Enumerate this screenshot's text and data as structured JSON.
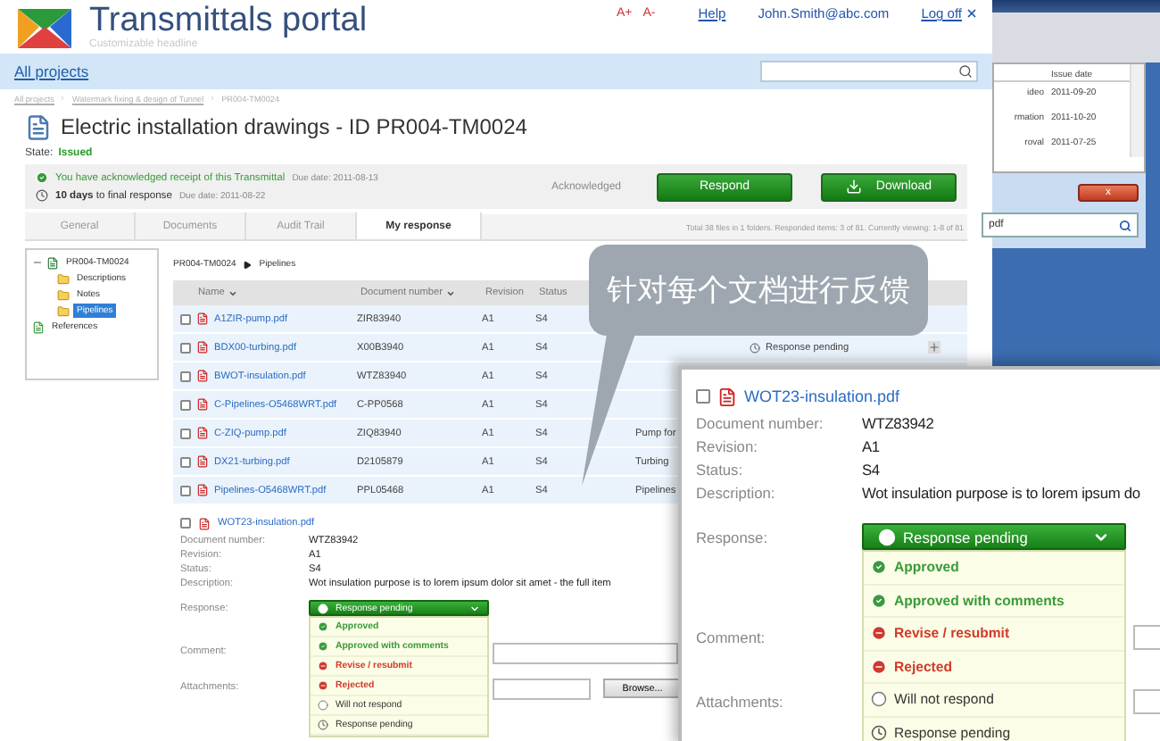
{
  "header": {
    "title": "Transmittals portal",
    "subtitle": "Customizable headline",
    "font_buttons": [
      "A+",
      "A-"
    ],
    "links": [
      "Help",
      "John.Smith@abc.com",
      "Log off"
    ]
  },
  "nav": {
    "link": "All projects"
  },
  "breadcrumb": [
    "All projects",
    "Watermark fixing & design of Tunnel",
    "PR004-TM0024"
  ],
  "page": {
    "title": "Electric installation drawings - ID PR004-TM0024",
    "state_label": "State:",
    "state": "Issued"
  },
  "notice": {
    "lines": [
      {
        "kind": "ack",
        "text": "You have acknowledged receipt of this Transmittal",
        "due": "Due date: 2011-08-13"
      },
      {
        "kind": "deadline",
        "text": "**10 days** to final response",
        "due": "Due date: 2011-08-22"
      }
    ],
    "status": "Acknowledged",
    "buttons": [
      {
        "kind": "respond",
        "label": "Respond"
      },
      {
        "kind": "download",
        "label": "Download"
      }
    ]
  },
  "tabs": [
    {
      "label": "General",
      "selected": false
    },
    {
      "label": "Documents",
      "selected": false
    },
    {
      "label": "Audit Trail",
      "selected": false
    },
    {
      "label": "My response",
      "selected": true
    }
  ],
  "summary": "Total 38 files in 1 folders. Responded items: 3 of 81. Currently viewing: 1-8 of 81",
  "tree": [
    {
      "label": "PR004-TM0024",
      "kind": "project",
      "expanded": true,
      "selected": false,
      "children": [
        {
          "label": "Descriptions",
          "kind": "folder",
          "selected": false
        },
        {
          "label": "Notes",
          "kind": "folder",
          "selected": false
        },
        {
          "label": "Pipelines",
          "kind": "folder",
          "selected": true
        }
      ]
    },
    {
      "label": "References",
      "kind": "references",
      "selected": false
    }
  ],
  "path": [
    "PR004-TM0024",
    "Pipelines"
  ],
  "table": {
    "columns": [
      {
        "label": "Name",
        "sortable": true
      },
      {
        "label": "Document number",
        "sortable": true
      },
      {
        "label": "Revision",
        "sortable": false
      },
      {
        "label": "Status",
        "sortable": false
      }
    ],
    "rows": [
      {
        "name": "A1ZIR-pump.pdf",
        "number": "ZIR83940",
        "revision": "A1",
        "status": "S4",
        "checked": false
      },
      {
        "name": "BDX00-turbing.pdf",
        "number": "X00B3940",
        "revision": "A1",
        "status": "S4",
        "checked": false,
        "response": "Response pending"
      },
      {
        "name": "BWOT-insulation.pdf",
        "number": "WTZ83940",
        "revision": "A1",
        "status": "S4",
        "checked": false
      },
      {
        "name": "C-Pipelines-O5468WRT.pdf",
        "number": "C-PP0568",
        "revision": "A1",
        "status": "S4",
        "checked": false
      },
      {
        "name": "C-ZIQ-pump.pdf",
        "number": "ZIQ83940",
        "revision": "A1",
        "status": "S4",
        "checked": false,
        "description": "Pump for"
      },
      {
        "name": "DX21-turbing.pdf",
        "number": "D2105879",
        "revision": "A1",
        "status": "S4",
        "checked": false,
        "description": "Turbing"
      },
      {
        "name": "Pipelines-O5468WRT.pdf",
        "number": "PPL05468",
        "revision": "A1",
        "status": "S4",
        "checked": false,
        "description": "Pipelines"
      }
    ]
  },
  "detail": {
    "file": "WOT23-insulation.pdf",
    "checked": false,
    "fields": [
      {
        "label": "Document number:",
        "value": "WTZ83942"
      },
      {
        "label": "Revision:",
        "value": "A1"
      },
      {
        "label": "Status:",
        "value": "S4"
      },
      {
        "label": "Description:",
        "value": "Wot insulation purpose is to lorem ipsum dolor sit amet - the full item"
      }
    ],
    "response_label": "Response:",
    "response": "Response pending",
    "options": [
      {
        "kind": "approved",
        "label": "Approved"
      },
      {
        "kind": "approved_comments",
        "label": "Approved with comments"
      },
      {
        "kind": "revise",
        "label": "Revise / resubmit"
      },
      {
        "kind": "rejected",
        "label": "Rejected"
      },
      {
        "kind": "none",
        "label": "Will not respond"
      },
      {
        "kind": "pending",
        "label": "Response pending"
      }
    ],
    "comment_label": "Comment:",
    "attachments_label": "Attachments:",
    "browse": "Browse..."
  },
  "zoom_panel": {
    "file": "WOT23-insulation.pdf",
    "checked": false,
    "fields": [
      {
        "label": "Document number:",
        "value": "WTZ83942"
      },
      {
        "label": "Revision:",
        "value": "A1"
      },
      {
        "label": "Status:",
        "value": "S4"
      },
      {
        "label": "Description:",
        "value": "Wot insulation purpose is to lorem ipsum do"
      }
    ],
    "response_label": "Response:",
    "response": "Response pending",
    "options": [
      {
        "kind": "approved",
        "label": "Approved"
      },
      {
        "kind": "approved_comments",
        "label": "Approved with comments"
      },
      {
        "kind": "revise",
        "label": "Revise / resubmit"
      },
      {
        "kind": "rejected",
        "label": "Rejected"
      },
      {
        "kind": "none",
        "label": "Will not respond"
      },
      {
        "kind": "pending",
        "label": "Response pending"
      }
    ],
    "comment_label": "Comment:",
    "attachments_label": "Attachments:"
  },
  "callout": "针对每个文档进行反馈",
  "side_window": {
    "columns": [
      "Issue date"
    ],
    "rows": [
      {
        "column_1": "ideo",
        "date": "2011-09-20"
      },
      {
        "column_1": "rmation",
        "date": "2011-10-20"
      },
      {
        "column_1": "roval",
        "date": "2011-07-25"
      }
    ],
    "close": "x",
    "search_value": "pdf"
  }
}
